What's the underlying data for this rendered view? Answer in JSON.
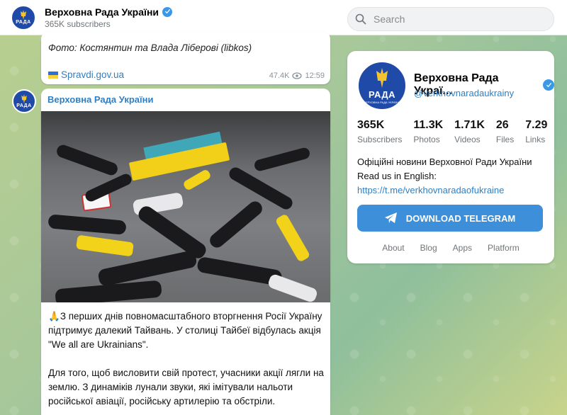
{
  "header": {
    "channel_name": "Верховна Рада України",
    "subscribers": "365K subscribers",
    "avatar_text": "РАДА",
    "search_placeholder": "Search"
  },
  "messages": [
    {
      "caption": "Фото: Костянтин та Влада Ліберові (libkos)",
      "link": "Spravdi.gov.ua",
      "views": "47.4K",
      "time": "12:59"
    },
    {
      "sender": "Верховна Рада України",
      "avatar_text": "РАДА",
      "text1_emoji": "🙏",
      "text1": "З перших днів повномасштабного вторгнення Росії Україну підтримує далекий Тайвань. У столиці Тайбеї відбулась акція \"We all are Ukrainians\".",
      "text2": "Для того, щоб висловити свій протест, учасники акції лягли на землю. З динаміків лунали звуки, які імітували нальоти російської авіації, російську артилерію та обстріли."
    }
  ],
  "panel": {
    "avatar_text": "РАДА",
    "avatar_subtext": "ВЕРХОВНА РАДА УКРАЇНИ",
    "name": "Верховна Рада Украї...",
    "handle": "@verkhovnaradaukrainy",
    "stats": [
      {
        "num": "365K",
        "label": "Subscribers"
      },
      {
        "num": "11.3K",
        "label": "Photos"
      },
      {
        "num": "1.71K",
        "label": "Videos"
      },
      {
        "num": "26",
        "label": "Files"
      },
      {
        "num": "7.29",
        "label": "Links"
      }
    ],
    "description_line1": "Офіційні новини Верховної Ради України",
    "description_line2": "Read us in English:",
    "description_url": "https://t.me/verkhovnaradaofukraine",
    "download_label": "DOWNLOAD TELEGRAM",
    "footer_links": [
      "About",
      "Blog",
      "Apps",
      "Platform"
    ]
  },
  "colors": {
    "accent": "#2f7fc2",
    "button": "#3c8fd8",
    "avatar_bg": "#1f4aa8",
    "verified": "#3b98e8"
  }
}
